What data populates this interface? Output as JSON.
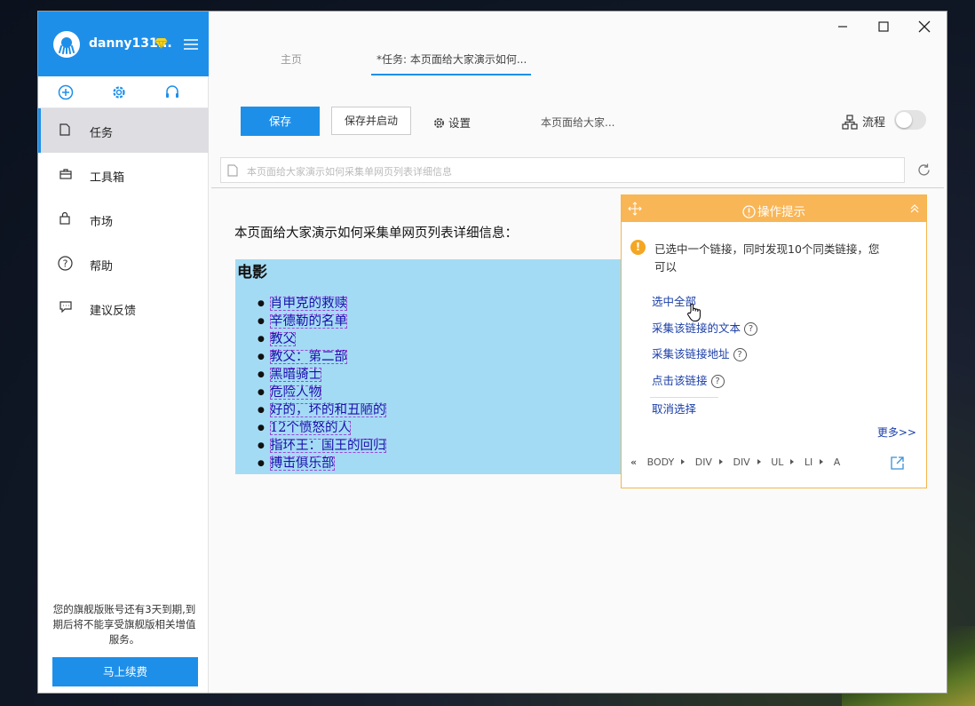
{
  "user": {
    "name": "danny131..."
  },
  "sidebar": {
    "items": [
      {
        "label": "任务",
        "icon": "document-icon",
        "active": true
      },
      {
        "label": "工具箱",
        "icon": "toolbox-icon",
        "active": false
      },
      {
        "label": "市场",
        "icon": "shopping-bag-icon",
        "active": false
      },
      {
        "label": "帮助",
        "icon": "help-icon",
        "active": false
      },
      {
        "label": "建议反馈",
        "icon": "feedback-icon",
        "active": false
      }
    ],
    "expire_notice": "您的旗舰版账号还有3天到期,到期后将不能享受旗舰版相关增值服务。",
    "renew_label": "马上续费"
  },
  "tabs": {
    "home": "主页",
    "task": "*任务: 本页面给大家演示如何..."
  },
  "toolbar": {
    "save_label": "保存",
    "save_start_label": "保存并启动",
    "settings_label": "设置",
    "task_name": "本页面给大家...",
    "flow_label": "流程",
    "flow_enabled": false
  },
  "url_bar": {
    "value": "本页面给大家演示如何采集单网页列表详细信息"
  },
  "webpage": {
    "intro": "本页面给大家演示如何采集单网页列表详细信息：",
    "heading": "电影",
    "movies": [
      "肖申克的救赎",
      "辛德勒的名单",
      "教父",
      "教父：第二部",
      "黑暗骑士",
      "危险人物",
      "好的，坏的和丑陋的",
      "12个愤怒的人",
      "指环王：国王的回归",
      "搏击俱乐部"
    ]
  },
  "tips": {
    "title": "操作提示",
    "message": "已选中一个链接，同时发现10个同类链接，您可以",
    "actions": [
      "选中全部",
      "采集该链接的文本",
      "采集该链接地址",
      "点击该链接",
      "取消选择"
    ],
    "more": "更多>>",
    "path": [
      "BODY",
      "DIV",
      "DIV",
      "UL",
      "LI",
      "A"
    ]
  },
  "colors": {
    "accent": "#1e8fe9",
    "tips_header": "#f9b656",
    "selection_bg": "#a4dbf4"
  }
}
